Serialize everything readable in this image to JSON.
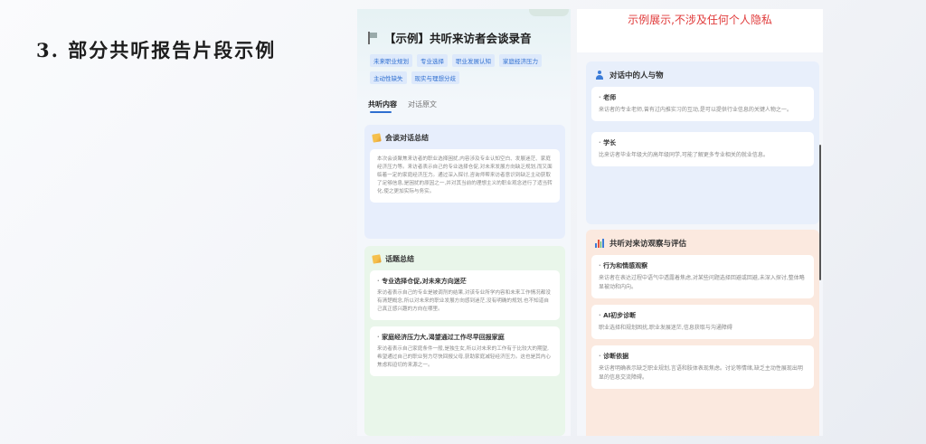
{
  "slide": {
    "title": "3. 部分共听报告片段示例"
  },
  "left": {
    "record_title": "【示例】共听来访者会谈录音",
    "tags": [
      "未来职业规划",
      "专业选择",
      "职业发展认知",
      "家庭经济压力",
      "主动性缺失",
      "现实与理想分歧"
    ],
    "tabs": [
      "共听内容",
      "对话原文"
    ],
    "summary": {
      "heading": "会谈对话总结",
      "body": "本次会谈聚焦来访者的职业选择困扰,内容涉及专业认知空白、发展迷茫、家庭经济压力等。来访者表示自己的专业选择仓促,对未来发展方向缺乏规划,而又面临着一定的家庭经济压力。通过深入探讨,咨询师帮来访者意识到缺乏主动获取了足够信息,是困扰的原因之一,并对其当前的理想主义的职业观念进行了适当转化,使之更加实际与务实。"
    },
    "topics": {
      "heading": "话题总结",
      "items": [
        {
          "title": "专业选择仓促,对未来方向迷茫",
          "body": "来访者表示自己的专业是被调剂的结果,对该专业所学内容和未来工作情况都没有清楚概念,所以对未来的职业发展方向感到迷茫,没有明确的规划,也不知道自己真正感兴趣的方向在哪里。"
        },
        {
          "title": "家庭经济压力大,渴望通过工作尽早回报家庭",
          "body": "来访者表示自己家庭条件一般,是独生女,所以对未来的工作有于比较大的期望,希望通过自己的职业努力尽快回报父母,获助家庭减轻经济压力。这也是其内心焦虑和迫切的来源之一。"
        }
      ]
    }
  },
  "right": {
    "notice": "示例展示,不涉及任何个人隐私",
    "people": {
      "heading": "对话中的人与物",
      "items": [
        {
          "title": "老师",
          "body": "来访者的专业老师,曾有过内推实习的互动,是可以提供行业信息的关键人物之一。"
        },
        {
          "title": "学长",
          "body": "比来访者毕业年级大的高年级同学,可能了解更多专业相关的就业信息。"
        }
      ]
    },
    "evaluation": {
      "heading": "共听对来访观察与评估",
      "items": [
        {
          "title": "行为和情感观察",
          "body": "来访者在表达过程中语气中透露着焦虑,对某些问题选择回避或回避,未深入探讨,整体略显被动和内向。"
        },
        {
          "title": "AI初步诊断",
          "body": "职业选择和规划困扰,职业发展迷茫,信息获取与沟通障碍"
        },
        {
          "title": "诊断依据",
          "body": "来访者明确表示缺乏职业规划,言语和肢体表现焦虑。讨论等情绪,缺乏主动性展现出明显的信息交流障碍。"
        }
      ]
    }
  }
}
